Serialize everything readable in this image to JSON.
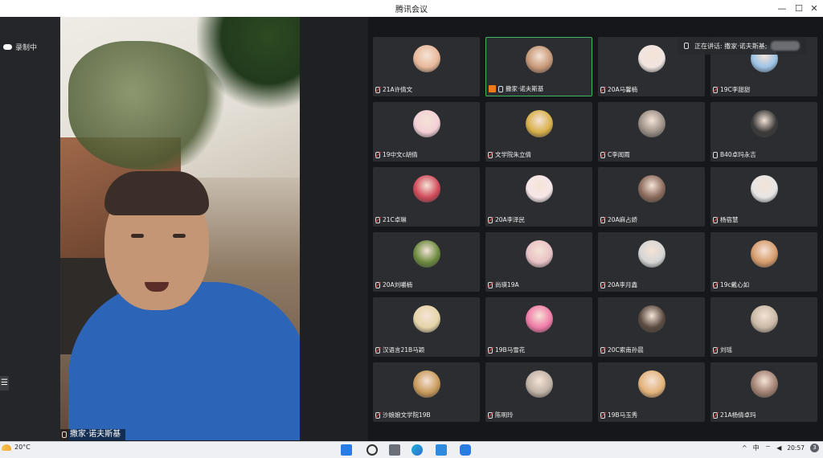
{
  "window": {
    "title": "腾讯会议",
    "minimize_icon": "minimize-icon",
    "maximize_icon": "maximize-icon",
    "close_icon": "close-icon"
  },
  "recording": {
    "label": "录制中",
    "icon": "cloud-icon"
  },
  "main_speaker": {
    "name": "撒家·诺夫斯基",
    "icon": "microphone-icon"
  },
  "speaking_now": {
    "label": "正在讲话: 撒家·诺夫斯基;"
  },
  "participants": [
    {
      "name": "21A许倩文",
      "muted": true,
      "color": "#e8b89a"
    },
    {
      "name": "撒家·诺夫斯基",
      "muted": false,
      "host": true,
      "active": true,
      "color": "#c59676"
    },
    {
      "name": "20A马馨楠",
      "muted": true,
      "color": "#f0e5e0"
    },
    {
      "name": "19C李甜甜",
      "muted": true,
      "color": "#9cc3e6"
    },
    {
      "name": "19中文c胡倩",
      "muted": true,
      "color": "#f3d0d6"
    },
    {
      "name": "文学院朱立倩",
      "muted": true,
      "color": "#d8b04a"
    },
    {
      "name": "C李闻雨",
      "muted": true,
      "color": "#9a8f86"
    },
    {
      "name": "B40卓玛永吉",
      "muted": false,
      "color": "#3a3a3a"
    },
    {
      "name": "21C卓琳",
      "muted": true,
      "color": "#d04a5a"
    },
    {
      "name": "20A李泽民",
      "muted": true,
      "color": "#f7e7ea"
    },
    {
      "name": "20A麻占娇",
      "muted": true,
      "color": "#8a6a5a"
    },
    {
      "name": "杨宿慧",
      "muted": true,
      "color": "#e6e6e6"
    },
    {
      "name": "20A刘嚼楠",
      "muted": true,
      "color": "#6b8a3e"
    },
    {
      "name": "尚瑛19A",
      "muted": true,
      "color": "#e8c2c6"
    },
    {
      "name": "20A李月鑫",
      "muted": true,
      "color": "#d6d6d6"
    },
    {
      "name": "19c戴心如",
      "muted": true,
      "color": "#d59a6a"
    },
    {
      "name": "汉语言21B马颖",
      "muted": true,
      "color": "#e6d4a8"
    },
    {
      "name": "19B马雪花",
      "muted": true,
      "color": "#f07aa8"
    },
    {
      "name": "20C索南孙晨",
      "muted": true,
      "color": "#5a4a40"
    },
    {
      "name": "刘瑶",
      "muted": true,
      "color": "#c8b8a4"
    },
    {
      "name": "沙娘娘文学院19B",
      "muted": true,
      "color": "#c89a5a"
    },
    {
      "name": "陈明玲",
      "muted": true,
      "color": "#bfb2a6"
    },
    {
      "name": "19B马玉秀",
      "muted": true,
      "color": "#e3b27a"
    },
    {
      "name": "21A杨倩卓玛",
      "muted": true,
      "color": "#a08070"
    }
  ],
  "taskbar": {
    "weather_temp": "20°C",
    "clock_time": "20:57",
    "ime_label": "中",
    "notification_count": "3",
    "apps": [
      "windows-start-icon",
      "search-icon",
      "task-view-icon",
      "edge-browser-icon",
      "photos-icon",
      "tencent-meeting-icon"
    ]
  }
}
